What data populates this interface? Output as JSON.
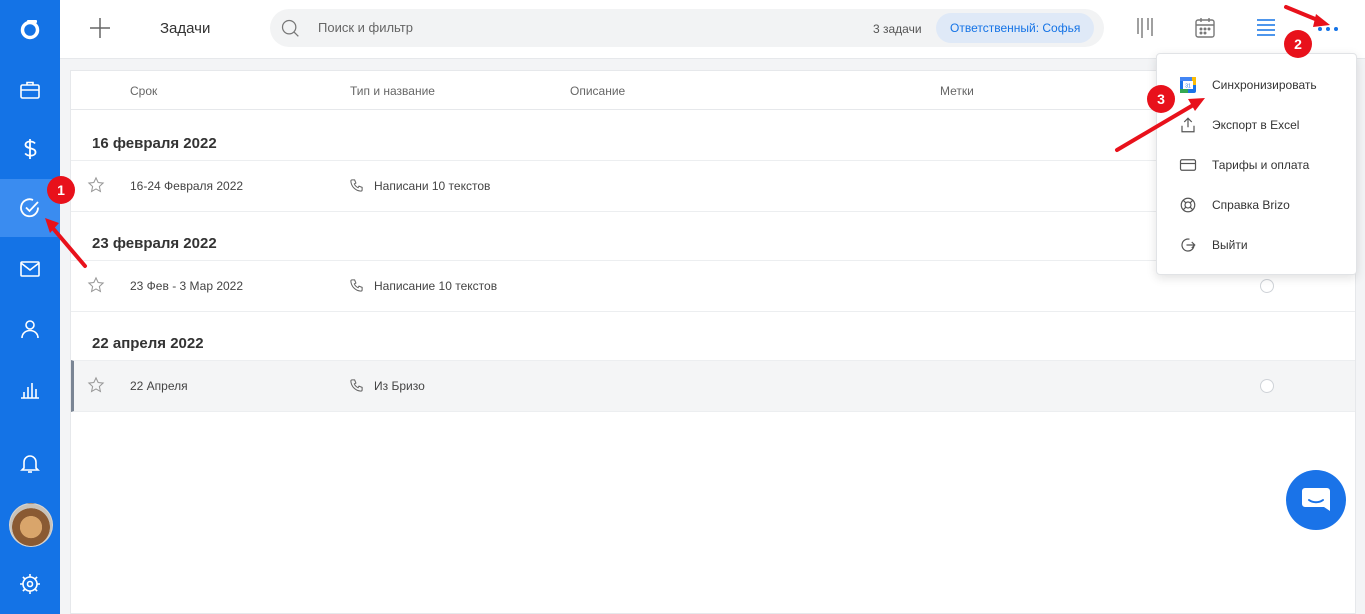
{
  "header": {
    "title": "Задачи",
    "search_placeholder": "Поиск и фильтр",
    "task_count": "3 задачи",
    "filter_chip": "Ответственный: Софья"
  },
  "table": {
    "columns": [
      "Срок",
      "Тип и название",
      "Описание",
      "Метки"
    ],
    "groups": [
      {
        "title": "16 февраля 2022",
        "rows": [
          {
            "date": "16-24 Февраля 2022",
            "name": "Написани 10 текстов"
          }
        ]
      },
      {
        "title": "23 февраля 2022",
        "rows": [
          {
            "date": "23 Фев - 3 Мар 2022",
            "name": "Написание 10 текстов"
          }
        ]
      },
      {
        "title": "22 апреля 2022",
        "rows": [
          {
            "date": "22 Апреля",
            "name": "Из Бризо"
          }
        ]
      }
    ]
  },
  "menu": {
    "items": [
      {
        "label": "Синхронизировать",
        "icon": "google-calendar-icon"
      },
      {
        "label": "Экспорт в Excel",
        "icon": "export-icon"
      },
      {
        "label": "Тарифы и оплата",
        "icon": "credit-card-icon"
      },
      {
        "label": "Справка Brizo",
        "icon": "lifebuoy-icon"
      },
      {
        "label": "Выйти",
        "icon": "logout-icon"
      }
    ]
  },
  "sidebar": {
    "items": [
      "logo-icon",
      "briefcase-icon",
      "dollar-icon",
      "tasks-check-icon",
      "mail-icon",
      "contact-icon",
      "analytics-icon",
      "bell-icon",
      "avatar",
      "settings-icon"
    ],
    "active": "tasks-check-icon"
  },
  "annotations": {
    "markers": [
      "1",
      "2",
      "3"
    ]
  },
  "colors": {
    "brand": "#1473e6",
    "marker": "#e8111b",
    "chip_bg": "#dfe9f7"
  }
}
